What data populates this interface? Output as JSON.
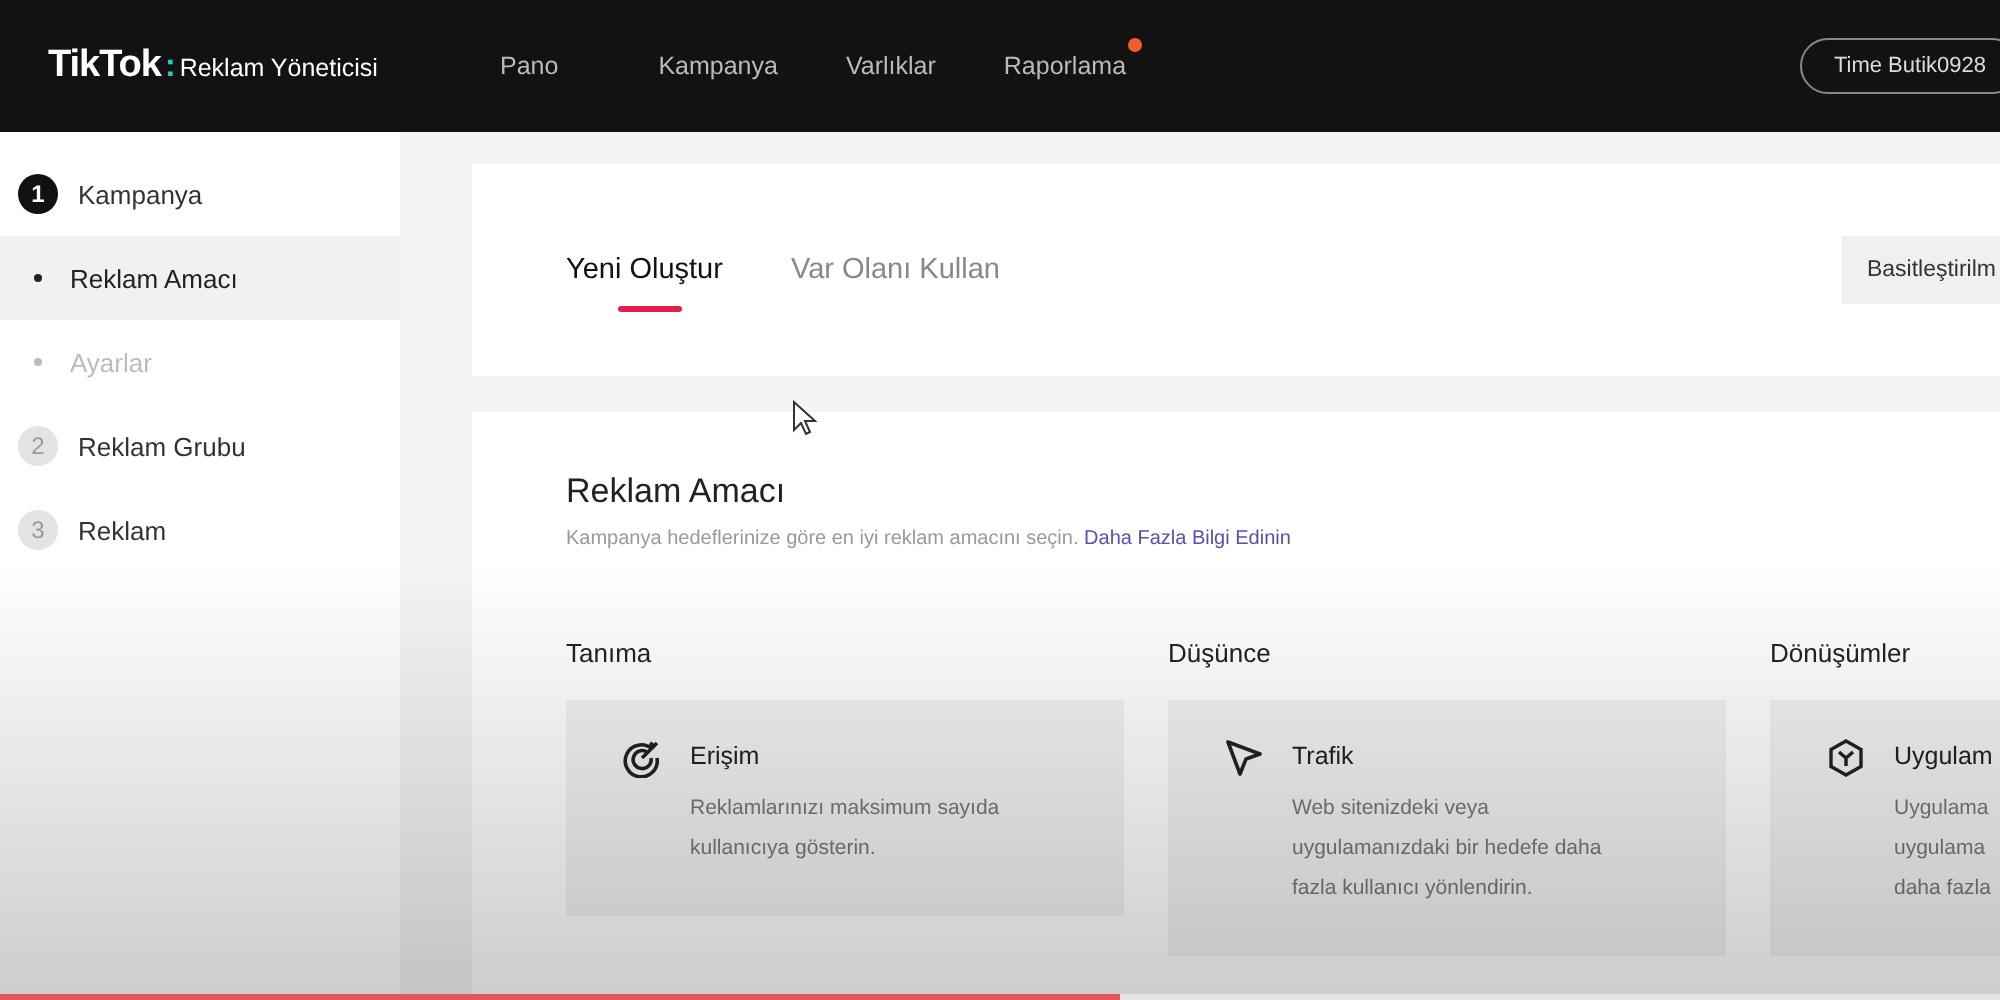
{
  "topbar": {
    "logo": "TikTok",
    "logo_sep": ":",
    "product": "Reklam Yöneticisi",
    "nav": [
      {
        "label": "Pano",
        "dot": false
      },
      {
        "label": "Kampanya",
        "dot": false
      },
      {
        "label": "Varlıklar",
        "dot": false
      },
      {
        "label": "Raporlama",
        "dot": true
      }
    ],
    "account": "Time Butik0928"
  },
  "sidebar": {
    "steps": [
      {
        "kind": "step",
        "number": "1",
        "label": "Kampanya",
        "selected": true
      },
      {
        "kind": "sub",
        "label": "Reklam Amacı",
        "selected": true
      },
      {
        "kind": "sub",
        "label": "Ayarlar",
        "selected": false
      },
      {
        "kind": "step",
        "number": "2",
        "label": "Reklam Grubu",
        "selected": false
      },
      {
        "kind": "step",
        "number": "3",
        "label": "Reklam",
        "selected": false
      }
    ]
  },
  "tabs": [
    {
      "label": "Yeni Oluştur",
      "selected": true
    },
    {
      "label": "Var Olanı Kullan",
      "selected": false
    }
  ],
  "mode_button": "Basitleştirilm",
  "objective": {
    "title": "Reklam Amacı",
    "description": "Kampanya hedeflerinize göre en iyi reklam amacını seçin.",
    "link": "Daha Fazla Bilgi Edinin",
    "groups": [
      {
        "heading": "Tanıma",
        "option": {
          "kind": "reach",
          "title": "Erişim",
          "lines": [
            "Reklamlarınızı maksimum sayıda",
            "kullanıcıya gösterin."
          ]
        }
      },
      {
        "heading": "Düşünce",
        "option": {
          "kind": "traffic",
          "title": "Trafik",
          "lines": [
            "Web sitenizdeki veya",
            "uygulamanızdaki bir hedefe daha",
            "fazla kullanıcı yönlendirin."
          ]
        }
      },
      {
        "heading": "Dönüşümler",
        "option": {
          "kind": "app",
          "title": "Uygulam",
          "lines": [
            "Uygulama",
            "uygulama",
            "daha fazla"
          ]
        }
      }
    ]
  },
  "video_progress": {
    "level": 0.56
  }
}
